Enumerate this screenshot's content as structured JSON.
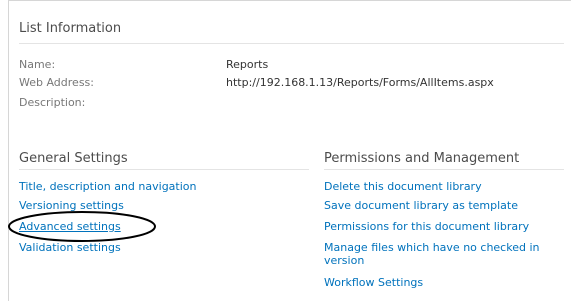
{
  "list_information": {
    "title": "List Information",
    "fields": [
      {
        "label": "Name:",
        "value": "Reports"
      },
      {
        "label": "Web Address:",
        "value": "http://192.168.1.13/Reports/Forms/AllItems.aspx"
      },
      {
        "label": "Description:",
        "value": ""
      }
    ]
  },
  "general_settings": {
    "title": "General Settings",
    "links": [
      "Title, description and navigation",
      "Versioning settings",
      "Advanced settings",
      "Validation settings"
    ]
  },
  "permissions": {
    "title": "Permissions and Management",
    "links": [
      "Delete this document library",
      "Save document library as template",
      "Permissions for this document library",
      "Manage files which have no checked in",
      "version",
      "Workflow Settings"
    ]
  },
  "colors": {
    "link": "#0072bc",
    "highlight_oval": "#000000"
  }
}
